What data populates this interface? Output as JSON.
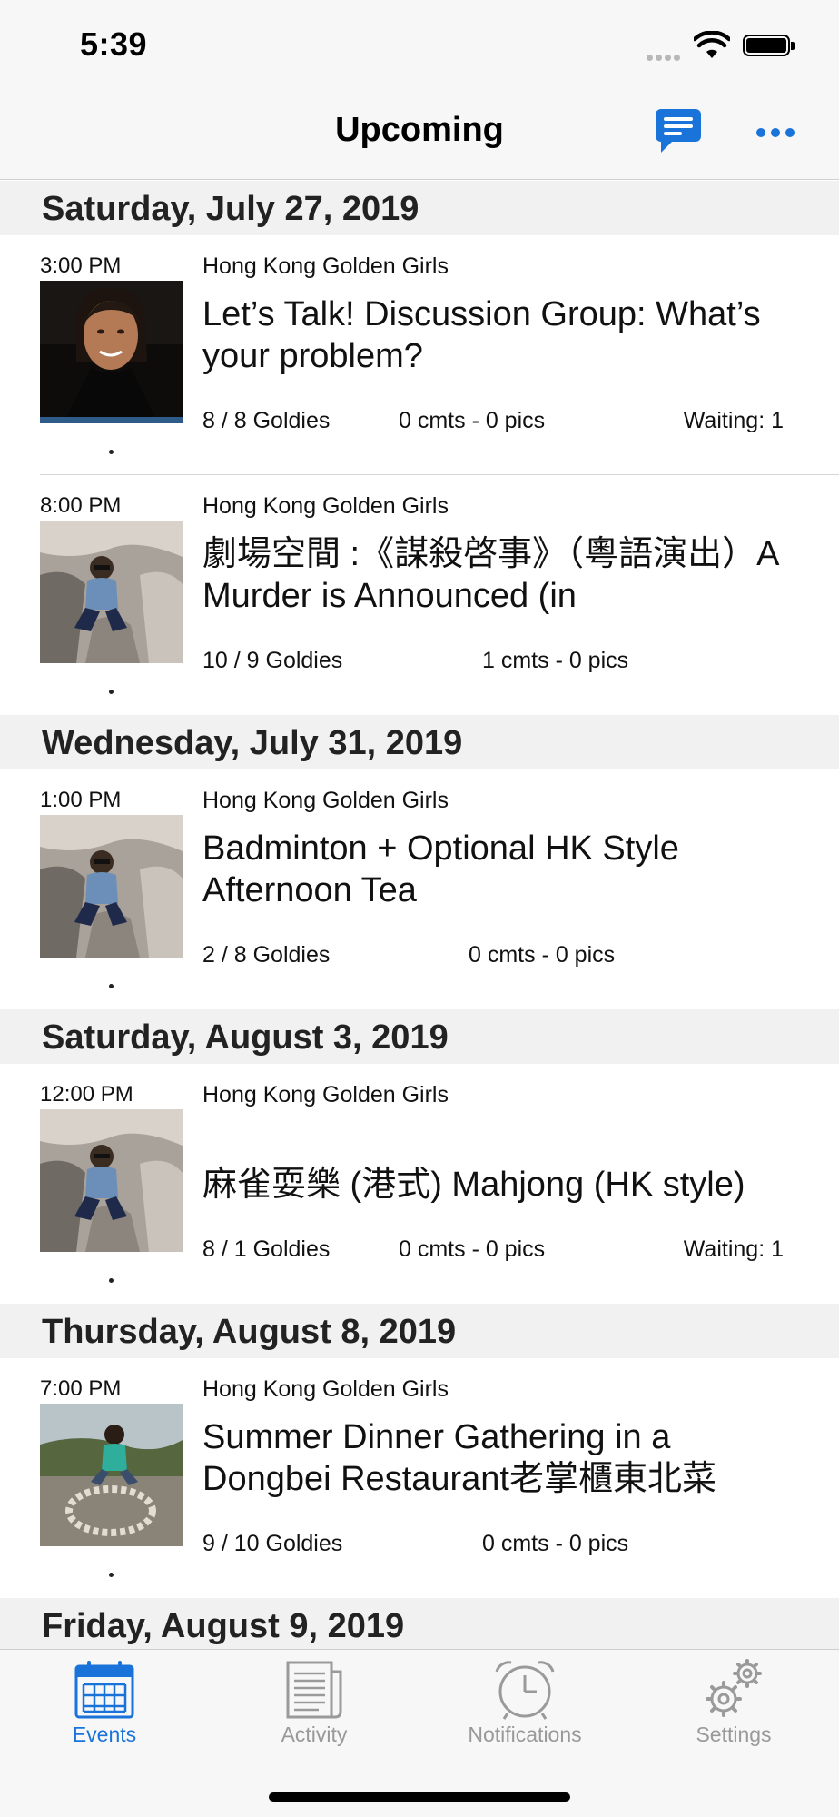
{
  "status_bar": {
    "time": "5:39"
  },
  "nav": {
    "title": "Upcoming",
    "chat_icon": "chat-bubble-icon",
    "more_icon": "more-icon"
  },
  "colors": {
    "accent": "#1a73d9",
    "inactive": "#999999",
    "header_bg": "#f1f1f1",
    "bar_bg": "#f7f7f7"
  },
  "days": [
    {
      "date": "Saturday, July 27, 2019",
      "events": [
        {
          "time": "3:00 PM",
          "group": "Hong Kong Golden Girls",
          "title": "Let’s Talk! Discussion Group: What’s your problem?",
          "count": "8 / 8 Goldies",
          "comments": "0 cmts - 0 pics",
          "waiting": "Waiting: 1",
          "photo": "portrait"
        },
        {
          "time": "8:00 PM",
          "group": "Hong Kong Golden Girls",
          "title": "劇場空間 :《謀殺啓事》（粵語演出）A Murder is Announced (in",
          "count": "10 / 9 Goldies",
          "comments": "1 cmts - 0 pics",
          "waiting": "",
          "photo": "rock"
        }
      ]
    },
    {
      "date": "Wednesday, July 31, 2019",
      "events": [
        {
          "time": "1:00 PM",
          "group": "Hong Kong Golden Girls",
          "title": "Badminton + Optional HK Style Afternoon Tea",
          "count": "2 / 8 Goldies",
          "comments": "0 cmts - 0 pics",
          "waiting": "",
          "photo": "rock"
        }
      ]
    },
    {
      "date": "Saturday, August 3, 2019",
      "events": [
        {
          "time": "12:00 PM",
          "group": "Hong Kong Golden Girls",
          "title": "麻雀耍樂 (港式) Mahjong (HK style)",
          "count": "8 / 1 Goldies",
          "comments": "0 cmts - 0 pics",
          "waiting": "Waiting: 1",
          "photo": "rock"
        }
      ]
    },
    {
      "date": "Thursday, August 8, 2019",
      "events": [
        {
          "time": "7:00 PM",
          "group": "Hong Kong Golden Girls",
          "title": "Summer Dinner Gathering in a Dongbei Restaurant老掌櫃東北菜",
          "count": "9 / 10 Goldies",
          "comments": "0 cmts - 0 pics",
          "waiting": "",
          "photo": "outdoor"
        }
      ]
    },
    {
      "date": "Friday, August 9, 2019",
      "events": []
    }
  ],
  "tabs": [
    {
      "label": "Events",
      "icon": "calendar-icon",
      "active": true
    },
    {
      "label": "Activity",
      "icon": "newspaper-icon",
      "active": false
    },
    {
      "label": "Notifications",
      "icon": "alarm-clock-icon",
      "active": false
    },
    {
      "label": "Settings",
      "icon": "gears-icon",
      "active": false
    }
  ]
}
